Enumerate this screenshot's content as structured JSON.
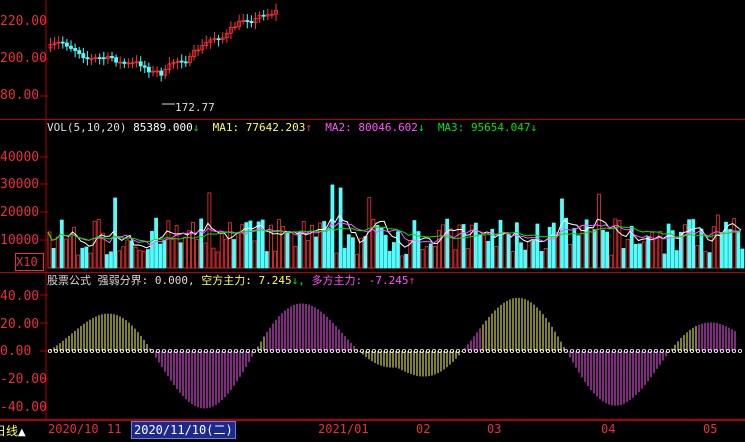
{
  "price_panel": {
    "ticks": [
      "220.00",
      "200.00",
      "80.00"
    ],
    "low_marker": "172.77"
  },
  "volume_panel": {
    "legend": {
      "title": "VOL(5,10,20)",
      "value": "85389.000",
      "value_arrow": "↓",
      "ma1_label": "MA1:",
      "ma1_value": "77642.203",
      "ma1_arrow": "↑",
      "ma2_label": "MA2:",
      "ma2_value": "80046.602",
      "ma2_arrow": "↓",
      "ma3_label": "MA3:",
      "ma3_value": "95654.047",
      "ma3_arrow": "↓"
    },
    "ticks": [
      "40000",
      "30000",
      "20000",
      "10000"
    ],
    "unit_box": "X10"
  },
  "indicator_panel": {
    "legend": {
      "name": "股票公式",
      "threshold_label": "强弱分界:",
      "threshold_value": "0.000,",
      "bear_label": "空方主力:",
      "bear_value": "7.245",
      "bear_arrow": "↓,",
      "bull_label": "多方主力:",
      "bull_value": "-7.245",
      "bull_arrow": "↑"
    },
    "ticks": [
      "40.00",
      "20.00",
      "0.00",
      "-20.00",
      "-40.00"
    ]
  },
  "date_bar": {
    "left_label": "日线",
    "arrow": "▲",
    "labels": [
      "2020/10",
      "11",
      "2021/01",
      "02",
      "03",
      "04",
      "05"
    ],
    "selected": "2020/11/10(二)"
  },
  "colors": {
    "background": "#000000",
    "up": "#ff3232",
    "down": "#54fcfc",
    "ma1": "#ffffff",
    "ma2": "#ffff54",
    "ma3": "#ff54ff",
    "ma_long": "#00e600",
    "grid": "#b00000"
  }
}
